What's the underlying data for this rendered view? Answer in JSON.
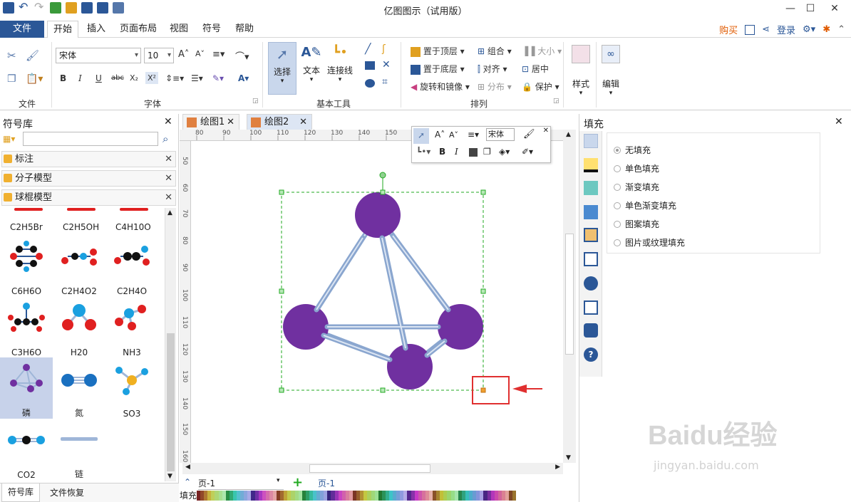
{
  "app": {
    "title": "亿图图示（试用版）"
  },
  "menu": {
    "file": "文件",
    "tabs": [
      "开始",
      "插入",
      "页面布局",
      "视图",
      "符号",
      "帮助"
    ],
    "buy": "购买",
    "login": "登录"
  },
  "ribbon": {
    "groups": {
      "file": "文件",
      "font": "字体",
      "basic_tools": "基本工具",
      "arrange": "排列"
    },
    "font_name": "宋体",
    "font_size": "10",
    "select": "选择",
    "text": "文本",
    "connector": "连接线",
    "bring_top": "置于顶层",
    "send_bottom": "置于底层",
    "rotate_mirror": "旋转和镜像",
    "group": "组合",
    "align": "对齐",
    "distribute": "分布",
    "size": "大小",
    "center": "居中",
    "protect": "保护",
    "style": "样式",
    "edit": "编辑"
  },
  "left": {
    "title": "符号库",
    "search_placeholder": "",
    "libraries": [
      "标注",
      "分子模型",
      "球棍模型"
    ],
    "partial_labels": [
      "C2H5Br",
      "C2H5OH",
      "C4H10O"
    ],
    "shapes": [
      {
        "label": "C6H6O"
      },
      {
        "label": "C2H4O2"
      },
      {
        "label": "C2H4O"
      },
      {
        "label": "C3H6O"
      },
      {
        "label": "H20"
      },
      {
        "label": "NH3"
      },
      {
        "label": "磷"
      },
      {
        "label": "氮"
      },
      {
        "label": "SO3"
      },
      {
        "label": "CO2"
      },
      {
        "label": "链"
      }
    ],
    "bottom_tabs": [
      "符号库",
      "文件恢复"
    ]
  },
  "canvas": {
    "tabs": [
      "绘图1",
      "绘图2"
    ],
    "ruler_h": [
      "80",
      "90",
      "100",
      "110",
      "120",
      "130",
      "140",
      "150"
    ],
    "ruler_v": [
      "50",
      "60",
      "70",
      "80",
      "90",
      "100",
      "110",
      "120",
      "130",
      "140",
      "150",
      "160"
    ],
    "page_label": "页-1",
    "page_tab": "页-1",
    "fill_label": "填充",
    "mini_font": "宋体"
  },
  "right": {
    "title": "填充",
    "options": [
      "无填充",
      "单色填充",
      "渐变填充",
      "单色渐变填充",
      "图案填充",
      "图片或纹理填充"
    ],
    "selected": 0
  },
  "colors": {
    "accent": "#2b5797",
    "molecule": "#7030a0",
    "bond": "#9fb6d8",
    "selection": "#22aa22",
    "arrow": "#e03030"
  },
  "watermark": {
    "text": "Baidu经验",
    "url": "jingyan.baidu.com"
  }
}
